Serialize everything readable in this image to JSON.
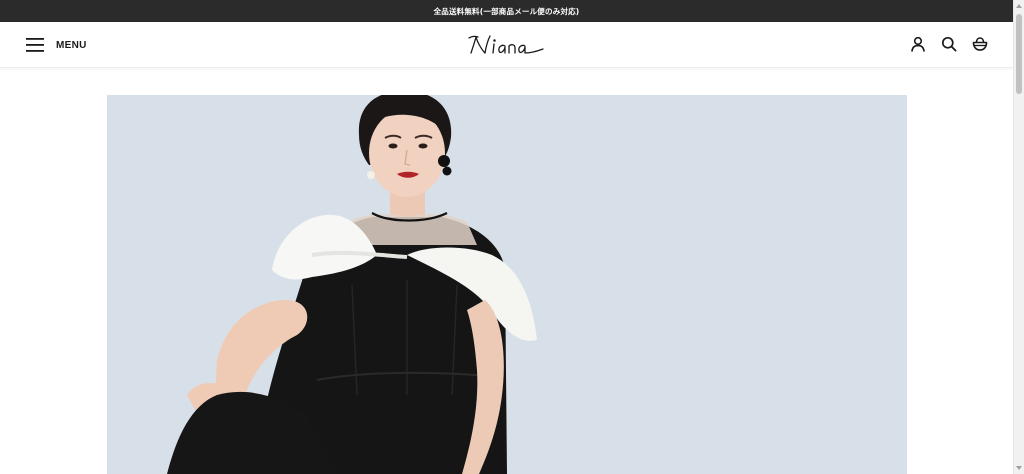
{
  "announcement": {
    "text": "全品送料無料(一部商品メール便のみ対応)"
  },
  "header": {
    "menu_label": "MENU",
    "logo_text": "Niana",
    "icons": [
      "account-icon",
      "search-icon",
      "cart-icon"
    ]
  },
  "hero": {
    "image": "model-in-black-dress-with-white-ruffle-collar"
  },
  "colors": {
    "announcement_bg": "#2b2b2b",
    "hero_bg": "#d4dee6"
  }
}
